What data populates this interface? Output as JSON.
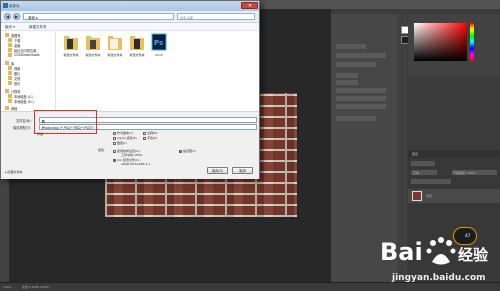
{
  "dialog": {
    "title": "另存为",
    "breadcrumb": "桌面 ▸",
    "search_placeholder": "搜索 桌面",
    "toolbar": [
      "组织 ▾",
      "新建文件夹"
    ],
    "sidebar": [
      "收藏夹",
      "下载",
      "桌面",
      "最近访问的位置",
      "2345Downloads",
      "库",
      "视频",
      "图片",
      "文档",
      "音乐",
      "计算机",
      "本地磁盘 (C:)",
      "本地磁盘 (D:)",
      "网络"
    ],
    "files": [
      {
        "label": "新建文件夹",
        "kind": "folder"
      },
      {
        "label": "新建文件夹",
        "kind": "folder"
      },
      {
        "label": "新建文件夹",
        "kind": "folder"
      },
      {
        "label": "新建文件夹",
        "kind": "folder"
      },
      {
        "label": "brick",
        "kind": "psd",
        "glyph": "Ps"
      }
    ],
    "filename_label": "文件名(N):",
    "filename_value": "砖",
    "filetype_label": "保存类型(T):",
    "filetype_value": "Photoshop (*.PSD;*.PDD;*.PSDT)",
    "options": {
      "save_label": "存储:",
      "col1": [
        "作为副本(Y)",
        "Alpha 通道(E)",
        "图层(L)"
      ],
      "col1_notes": [
        "注释(N)",
        "专色(P)"
      ],
      "color_label": "颜色:",
      "col2": [
        "使用校样设置(O):",
        "工作中的 CMYK",
        "ICC 配置文件(C):",
        "sRGB IEC61966-2.1"
      ],
      "thumbnail": "缩览图(T)"
    },
    "save_button": "保存(S)",
    "cancel_button": "取消",
    "hide_folders": "隐藏文件夹"
  },
  "ps": {
    "status_zoom": "100%",
    "status_doc": "文档:1.64M/1.64M",
    "layer_name": "背景",
    "layers_tab": "图层",
    "speed_badge": "47",
    "mode_label": "正常",
    "opacity_label": "不透明度: 100%"
  },
  "watermark": {
    "url": "jingyan.baidu.com"
  },
  "colors": {
    "brick": "#7d3a2c",
    "mortar": "#d8d0c4",
    "highlight": "#e0322a",
    "ps_bg": "#282828"
  }
}
